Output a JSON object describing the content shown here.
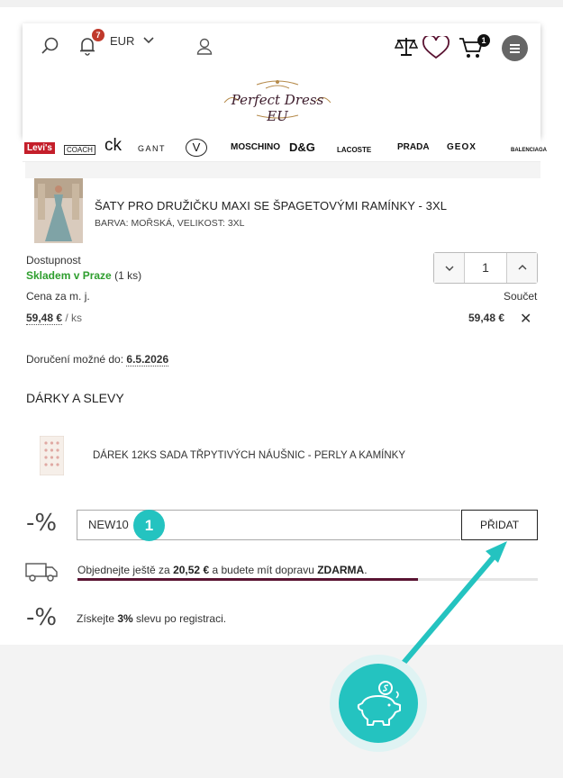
{
  "header": {
    "notification_count": "7",
    "currency": "EUR",
    "cart_count": "1",
    "logo_text": "Perfect Dress EU"
  },
  "brands": [
    "Levi's",
    "COACH",
    "ck",
    "GANT",
    "V",
    "MOSCHINO",
    "D&G",
    "LACOSTE",
    "PRADA",
    "GEOX",
    "BALENCIAGA"
  ],
  "product": {
    "name": "ŠATY PRO DRUŽIČKU MAXI SE ŠPAGETOVÝMI RAMÍNKY - 3XL",
    "variant": "BARVA: MOŘSKÁ, VELIKOST: 3XL",
    "availability_label": "Dostupnost",
    "availability_status": "Skladem v Praze",
    "availability_count": "(1 ks)",
    "quantity": "1",
    "unit_price_label": "Cena za m. j.",
    "unit_price": "59,48 €",
    "unit_suffix": "/ ks",
    "sum_label": "Součet",
    "sum_value": "59,48 €",
    "remove_glyph": "✕",
    "delivery_label": "Doručení možné do:",
    "delivery_date": "6.5.2026"
  },
  "gifts": {
    "title": "DÁRKY A SLEVY",
    "gift_name": "DÁREK 12KS SADA TŘPYTIVÝCH NÁUŠNIC - PERLY A KAMÍNKY"
  },
  "coupon": {
    "percent_icon": "-%",
    "value": "NEW10",
    "add_label": "PŘIDAT",
    "step_number": "1"
  },
  "shipping": {
    "text_before": "Objednejte ještě za ",
    "amount": "20,52 €",
    "text_middle": " a budete mít dopravu ",
    "free": "ZDARMA",
    "text_after": ".",
    "progress": 0.74
  },
  "registration": {
    "percent_icon": "-%",
    "text_before": "Získejte ",
    "discount": "3%",
    "text_middle": " slevu po ",
    "link": "registraci",
    "text_after": "."
  },
  "colors": {
    "accent": "#24c3c0",
    "in_stock": "#2e9e2e",
    "progress": "#5a1432",
    "badge": "#c0392b"
  }
}
